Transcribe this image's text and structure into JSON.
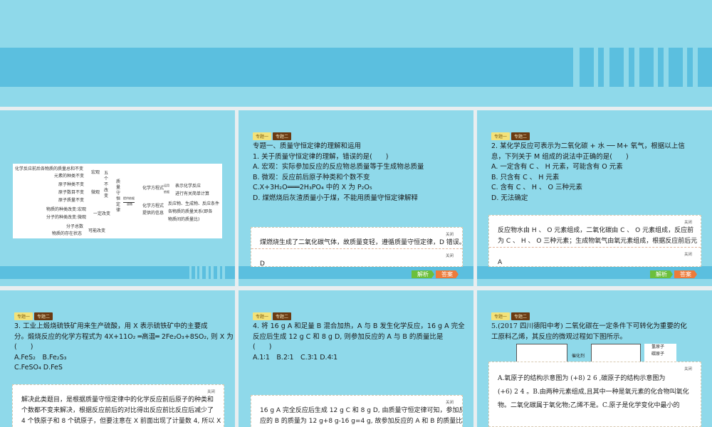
{
  "tags": [
    "专题一",
    "专题二"
  ],
  "close": "关闭",
  "buttons": {
    "analysis": "解析",
    "answer": "答案"
  },
  "diagram": {
    "left": [
      "化学反应前后各物质的质量总和不变",
      "元素的种类不变",
      "原子种类不变",
      "原子数目不变",
      "原子质量不变",
      "物质的种类改变:宏观",
      "分子的种类改变:微观",
      "分子总数",
      "物质的存在状态"
    ],
    "macro": "宏观",
    "micro": "微观",
    "five": "五个不改变",
    "must": "一定改变",
    "may": "可能改变",
    "center": "质量守恒定律",
    "arrow_top": "提供依据",
    "arrow_bottom": "遵循",
    "eq1": "化学方程式",
    "apply": "运用",
    "use": "依据",
    "r1": "表示化学反应",
    "r2": "进行有关简单计算",
    "eq2": "化学方程式提供的信息",
    "info": [
      "反应物、生成物、反应条件",
      "各物质的质量关系(即各",
      "物质间的质量比)"
    ]
  },
  "s2": {
    "lines": [
      "专题一、质量守恒定律的理解和运用",
      "1. 关于质量守恒定律的理解，错误的是(　　)",
      "A. 宏观：实际参加反应的反应物总质量等于生成物总质量",
      "B. 微观：反应前后原子种类和个数不变",
      "C.X+3H₂O═══2H₃PO₄ 中的 X 为 P₂O₅",
      "D. 煤燃烧后灰渣质量小于煤，不能用质量守恒定律解释"
    ],
    "analysis": "煤燃烧生成了二氧化碳气体，故质量变轻，遵循质量守恒定律，D 错误。",
    "answer": "D"
  },
  "s3": {
    "lines": [
      "2. 某化学反应可表示为二氧化碳 + 水 ── M+ 氧气，根据以上信",
      "息，下列关于 M 组成的说法中正确的是(　　)",
      "A. 一定含有 C 、 H 元素，可能含有 O 元素",
      "B. 只含有 C 、 H 元素",
      "C. 含有 C 、 H 、 O 三种元素",
      "D. 无法确定"
    ],
    "analysis": [
      "反应物水由 H 、 O 元素组成，二氧化碳由 C 、 O 元素组成，反应前",
      "为 C 、 H 、 O 三种元素；生成物氧气由氧元素组成，根据反应前后元"
    ],
    "answer": "A"
  },
  "s4": {
    "lines": [
      "3. 工业上煅烧硫铁矿用来生产硫酸，用 X 表示硫铁矿中的主要成",
      "分。煅烧反应的化学方程式为 4X+11O₂ ═高温═ 2Fe₂O₃+8SO₂, 则 X 为",
      "(　　)",
      "A.FeS₂　B.Fe₂S₃",
      "C.FeSO₄ D.FeS"
    ],
    "analysis": [
      "解决此类题目，是根据质量守恒定律中的化学反应前后原子的种类和",
      "个数都不变来解决，根据反应前后的对比得出反应前比反应后减少了",
      "4 个铁原子和 8 个硫原子，但要注意在 X 前面出现了计量数 4, 所以 X"
    ]
  },
  "s5": {
    "lines": [
      "4. 将 16 g A 和足量 B 混合加热，A 与 B 发生化学反应，16 g A 完全",
      "反应后生成 12 g C 和 8 g D, 则参加反应的 A 与 B 的质量比是",
      "(　　)",
      "A.1∶1　B.2∶1　C.3∶1 D.4∶1"
    ],
    "analysis": [
      "16 g A 完全反应后生成 12 g C 和 8 g D, 由质量守恒定律可知，参加反",
      "应的 B 的质量为 12 g+8 g-16 g=4 g, 故参加反应的 A 和 B 的质量比是"
    ]
  },
  "s6": {
    "lines": [
      "5.(2017 四川德阳中考) 二氧化碳在一定条件下可转化为重要的化",
      "工原料乙烯，其反应的微观过程如下图所示。"
    ],
    "catalyst": "催化剂",
    "legend": [
      "氢原子",
      "碳原子"
    ],
    "analysis": [
      "A.氧原子的结构示意图为 (+8) 2 6 ,碳原子的结构示意图为",
      "(+6) 2 4 。B.由两种元素组成,且其中一种是氧元素的化合物叫氧化",
      "物。二氧化碳属于氧化物;乙烯不是。C.原子是化学变化中最小的"
    ]
  }
}
